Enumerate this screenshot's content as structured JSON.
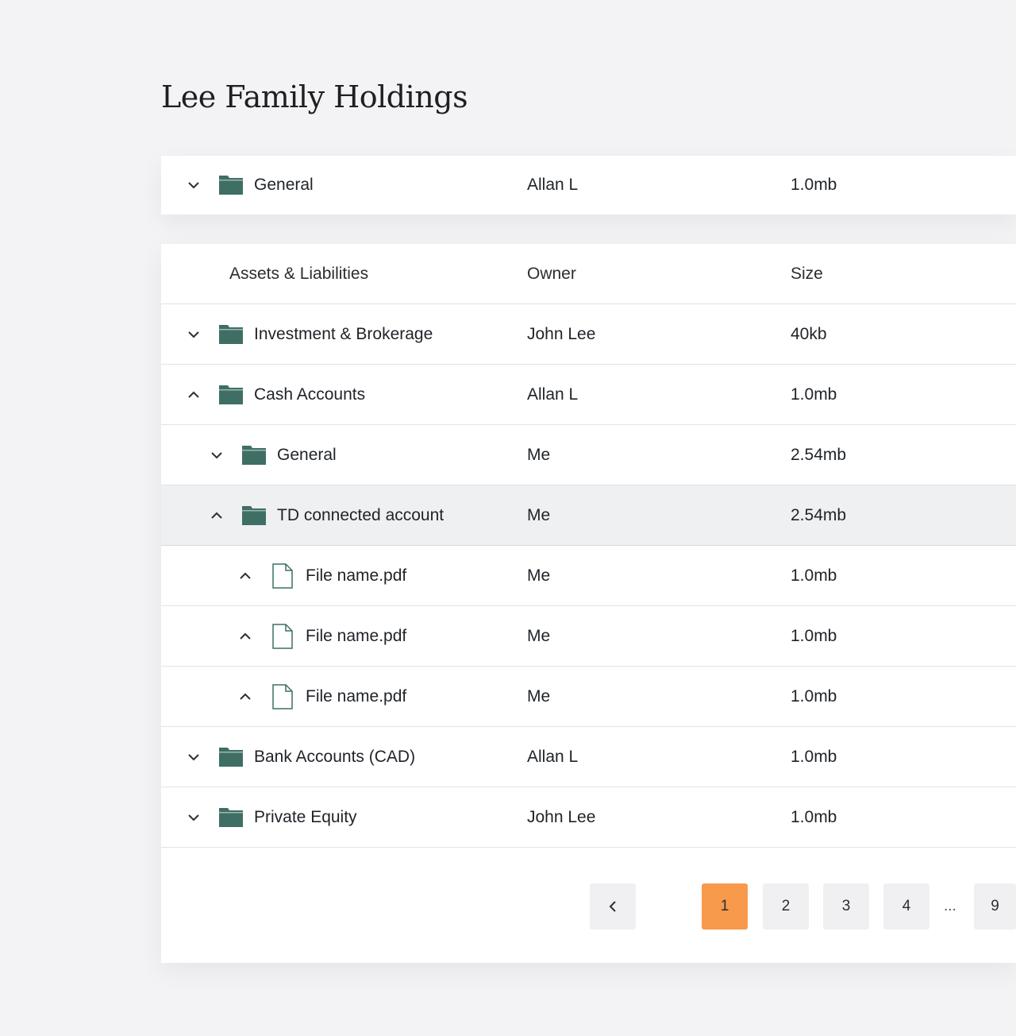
{
  "page": {
    "title": "Lee Family Holdings"
  },
  "colors": {
    "folder": "#3f6e65",
    "accent": "#f79a4c",
    "file_outline": "#3f6e65"
  },
  "top_row": {
    "name": "General",
    "owner": "Allan L",
    "size": "1.0mb",
    "chevron": "chevron-down-icon",
    "icon": "folder-icon"
  },
  "table": {
    "headers": {
      "name": "Assets & Liabilities",
      "owner": "Owner",
      "size": "Size"
    },
    "rows": [
      {
        "name": "Investment & Brokerage",
        "owner": "John Lee",
        "size": "40kb",
        "chevron": "down",
        "type": "folder"
      },
      {
        "name": "Cash Accounts",
        "owner": "Allan L",
        "size": "1.0mb",
        "chevron": "up",
        "type": "folder"
      },
      {
        "name": "General",
        "owner": "Me",
        "size": "2.54mb",
        "chevron": "down",
        "type": "folder"
      },
      {
        "name": "TD connected account",
        "owner": "Me",
        "size": "2.54mb",
        "chevron": "up",
        "type": "folder"
      },
      {
        "name": "File name.pdf",
        "owner": "Me",
        "size": "1.0mb",
        "chevron": "up",
        "type": "file"
      },
      {
        "name": "File name.pdf",
        "owner": "Me",
        "size": "1.0mb",
        "chevron": "up",
        "type": "file"
      },
      {
        "name": "File name.pdf",
        "owner": "Me",
        "size": "1.0mb",
        "chevron": "up",
        "type": "file"
      },
      {
        "name": "Bank Accounts (CAD)",
        "owner": "Allan L",
        "size": "1.0mb",
        "chevron": "down",
        "type": "folder"
      },
      {
        "name": "Private Equity",
        "owner": "John Lee",
        "size": "1.0mb",
        "chevron": "down",
        "type": "folder"
      }
    ]
  },
  "pagination": {
    "prev": "chevron-left-icon",
    "pages": [
      "1",
      "2",
      "3",
      "4"
    ],
    "active": "1",
    "ellipsis": "...",
    "last": "9"
  }
}
